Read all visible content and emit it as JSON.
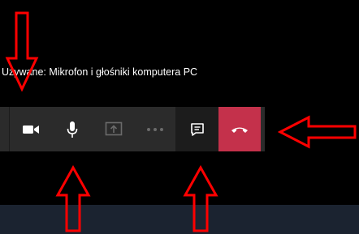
{
  "call": {
    "status_text": "Używane: Mikrofon i głośniki komputera PC"
  },
  "toolbar": {
    "buttons": [
      {
        "name": "camera",
        "icon": "video-camera-icon"
      },
      {
        "name": "microphone",
        "icon": "microphone-icon"
      },
      {
        "name": "share",
        "icon": "share-screen-icon"
      },
      {
        "name": "more",
        "icon": "more-options-icon"
      },
      {
        "name": "chat",
        "icon": "chat-icon"
      },
      {
        "name": "hang-up",
        "icon": "hang-up-icon"
      }
    ]
  },
  "colors": {
    "toolbar_bg": "#2b2b2b",
    "chat_bg": "#1c1c1c",
    "hangup_bg": "#c4314b",
    "annotation_arrow": "#ff0000",
    "bottom_band": "#1b2330"
  }
}
